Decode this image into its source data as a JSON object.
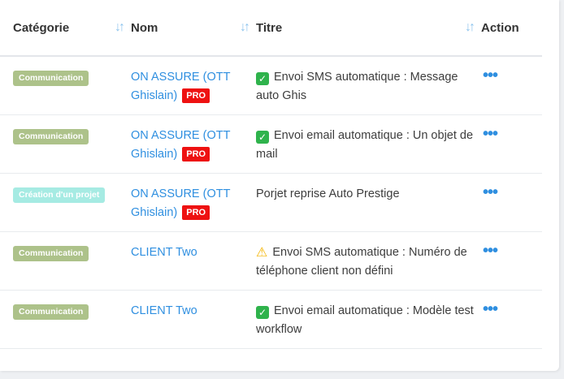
{
  "table": {
    "headers": {
      "categorie": "Catégorie",
      "nom": "Nom",
      "titre": "Titre",
      "action": "Action"
    },
    "sort_icon": "sort-icon",
    "pro_label": "PRO",
    "action_icon": "more-dots-icon",
    "rows": [
      {
        "category": "Communication",
        "category_color": "#adc28a",
        "name_line1": "ON ASSURE (OTT",
        "name_line2": "Ghislain)",
        "pro": true,
        "status_icon": "check-icon",
        "title": "Envoi SMS automatique : Message auto Ghis"
      },
      {
        "category": "Communication",
        "category_color": "#adc28a",
        "name_line1": "ON ASSURE (OTT",
        "name_line2": "Ghislain)",
        "pro": true,
        "status_icon": "check-icon",
        "title": "Envoi email automatique : Un objet de mail"
      },
      {
        "category": "Création d'un projet",
        "category_color": "#a6ebe3",
        "name_line1": "ON ASSURE (OTT",
        "name_line2": "Ghislain)",
        "pro": true,
        "status_icon": "",
        "title": "Porjet reprise Auto Prestige"
      },
      {
        "category": "Communication",
        "category_color": "#adc28a",
        "name_line1": "CLIENT Two",
        "name_line2": "",
        "pro": false,
        "status_icon": "warning-icon",
        "title": "Envoi SMS automatique : Numéro de téléphone client non défini"
      },
      {
        "category": "Communication",
        "category_color": "#adc28a",
        "name_line1": "CLIENT Two",
        "name_line2": "",
        "pro": false,
        "status_icon": "check-icon",
        "title": "Envoi email automatique : Modèle test workflow"
      }
    ]
  },
  "colors": {
    "link": "#2f8fe0",
    "pro_badge": "#ee1111",
    "check": "#2fb34c",
    "warning": "#f4b400",
    "sort_icon": "#8ec5ee"
  }
}
